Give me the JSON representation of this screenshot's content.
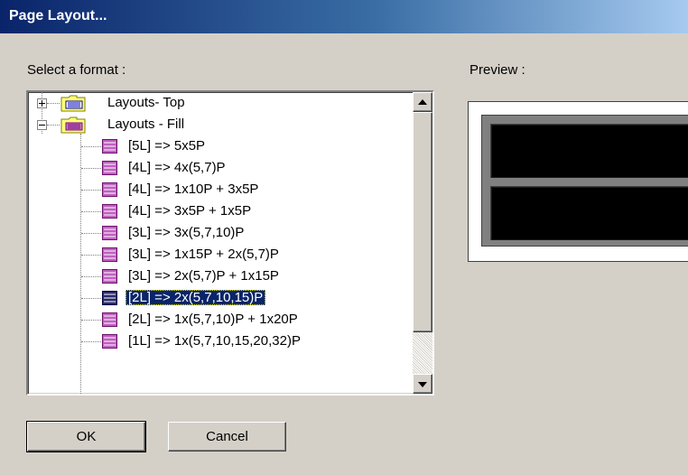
{
  "window": {
    "title": "Page Layout..."
  },
  "labels": {
    "select_format": "Select a format :",
    "preview": "Preview :"
  },
  "tree": {
    "groups": [
      {
        "label": "Layouts- Top",
        "expanded": false
      },
      {
        "label": "Layouts - Fill",
        "expanded": true
      }
    ],
    "children": [
      "[5L] => 5x5P",
      "[4L] => 4x(5,7)P",
      "[4L] => 1x10P + 3x5P",
      "[4L] => 3x5P + 1x5P",
      "[3L] => 3x(5,7,10)P",
      "[3L] => 1x15P + 2x(5,7)P",
      "[3L] => 2x(5,7)P + 1x15P",
      "[2L] => 2x(5,7,10,15)P",
      "[2L] => 1x(5,7,10)P + 1x20P",
      "[1L] => 1x(5,7,10,15,20,32)P"
    ],
    "selected_index": 7
  },
  "buttons": {
    "ok": "OK",
    "cancel": "Cancel"
  },
  "colors": {
    "titlebar": "#0a246a",
    "selection": "#0a246a",
    "face": "#d4d0c8",
    "folder": "#ffff80",
    "leaf_icon": "#9a2a9a"
  }
}
